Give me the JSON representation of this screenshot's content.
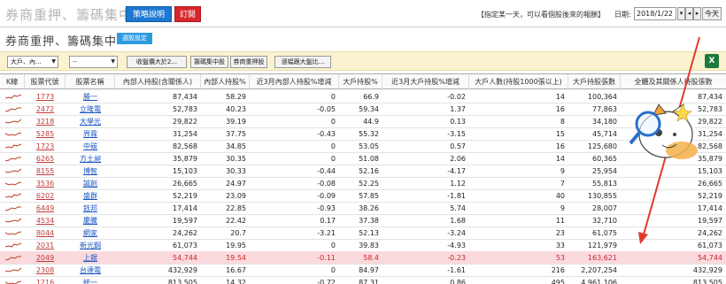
{
  "header": {
    "title": "券商重押、籌碼集中",
    "strategy_button": "策略說明",
    "subscribe_button": "訂閱",
    "hint": "【指定某一天，可以看個股後來的報酬】",
    "date_label": "日期:",
    "date_value": "2018/1/22",
    "today_button": "今天"
  },
  "subheader": {
    "title": "券商重押、籌碼集中",
    "filter_button": "選股設定"
  },
  "filters": {
    "market_select": "大戶、內...",
    "industry_select": "--",
    "buttons": [
      "收盤價大於2...",
      "籌碼集中股",
      "券商重押股",
      "漲幅跟大盤比..."
    ]
  },
  "table": {
    "columns": [
      "K線",
      "股票代號",
      "股票名稱",
      "內部人持股(含關係人)",
      "內部人持股%",
      "近3月內部人持股%增減",
      "大戶持股%",
      "近3月大戶持股%增減",
      "大戶人數(持股1000張以上)",
      "大戶持股張數",
      "全體及其關係人持股張數"
    ],
    "rows": [
      {
        "code": "1773",
        "name": "勝一",
        "insider": "87,434",
        "insider_pct": "58.29",
        "insider_chg": "0",
        "major_pct": "66.9",
        "major_chg": "-0.02",
        "holders": "14",
        "major_shares": "100,364",
        "all_shares": "87,434"
      },
      {
        "code": "2472",
        "name": "立隆電",
        "insider": "52,783",
        "insider_pct": "40.23",
        "insider_chg": "-0.05",
        "major_pct": "59.34",
        "major_chg": "1.37",
        "holders": "16",
        "major_shares": "77,863",
        "all_shares": "52,783"
      },
      {
        "code": "3218",
        "name": "大學光",
        "insider": "29,822",
        "insider_pct": "39.19",
        "insider_chg": "0",
        "major_pct": "44.9",
        "major_chg": "0.13",
        "holders": "8",
        "major_shares": "34,180",
        "all_shares": "29,822"
      },
      {
        "code": "5285",
        "name": "界霖",
        "insider": "31,254",
        "insider_pct": "37.75",
        "insider_chg": "-0.43",
        "major_pct": "55.32",
        "major_chg": "-3.15",
        "holders": "15",
        "major_shares": "45,714",
        "all_shares": "31,254"
      },
      {
        "code": "1723",
        "name": "中碳",
        "insider": "82,568",
        "insider_pct": "34.85",
        "insider_chg": "0",
        "major_pct": "53.05",
        "major_chg": "0.57",
        "holders": "16",
        "major_shares": "125,680",
        "all_shares": "82,568"
      },
      {
        "code": "6265",
        "name": "方土昶",
        "insider": "35,879",
        "insider_pct": "30.35",
        "insider_chg": "0",
        "major_pct": "51.08",
        "major_chg": "2.06",
        "holders": "14",
        "major_shares": "60,365",
        "all_shares": "35,879"
      },
      {
        "code": "8155",
        "name": "博智",
        "insider": "15,103",
        "insider_pct": "30.33",
        "insider_chg": "-0.44",
        "major_pct": "52.16",
        "major_chg": "-4.17",
        "holders": "9",
        "major_shares": "25,954",
        "all_shares": "15,103"
      },
      {
        "code": "3536",
        "name": "誠創",
        "insider": "26,665",
        "insider_pct": "24.97",
        "insider_chg": "-0.08",
        "major_pct": "52.25",
        "major_chg": "1.12",
        "holders": "7",
        "major_shares": "55,813",
        "all_shares": "26,665"
      },
      {
        "code": "6202",
        "name": "盛群",
        "insider": "52,219",
        "insider_pct": "23.09",
        "insider_chg": "-0.09",
        "major_pct": "57.85",
        "major_chg": "-1.81",
        "holders": "40",
        "major_shares": "130,855",
        "all_shares": "52,219"
      },
      {
        "code": "6449",
        "name": "鈺邦",
        "insider": "17,414",
        "insider_pct": "22.85",
        "insider_chg": "-0.93",
        "major_pct": "38.26",
        "major_chg": "5.74",
        "holders": "9",
        "major_shares": "28,007",
        "all_shares": "17,414"
      },
      {
        "code": "4534",
        "name": "慶騰",
        "insider": "19,597",
        "insider_pct": "22.42",
        "insider_chg": "0.17",
        "major_pct": "37.38",
        "major_chg": "1.68",
        "holders": "11",
        "major_shares": "32,710",
        "all_shares": "19,597"
      },
      {
        "code": "8044",
        "name": "網家",
        "insider": "24,262",
        "insider_pct": "20.7",
        "insider_chg": "-3.21",
        "major_pct": "52.13",
        "major_chg": "-3.24",
        "holders": "23",
        "major_shares": "61,075",
        "all_shares": "24,262"
      },
      {
        "code": "2031",
        "name": "新光鋼",
        "insider": "61,073",
        "insider_pct": "19.95",
        "insider_chg": "0",
        "major_pct": "39.83",
        "major_chg": "-4.93",
        "holders": "33",
        "major_shares": "121,979",
        "all_shares": "61,073"
      },
      {
        "code": "2049",
        "name": "上銀",
        "insider": "54,744",
        "insider_pct": "19.54",
        "insider_chg": "-0.11",
        "major_pct": "58.4",
        "major_chg": "-0.23",
        "holders": "53",
        "major_shares": "163,621",
        "all_shares": "54,744",
        "highlight": true
      },
      {
        "code": "2308",
        "name": "台達電",
        "insider": "432,929",
        "insider_pct": "16.67",
        "insider_chg": "0",
        "major_pct": "84.97",
        "major_chg": "-1.61",
        "holders": "216",
        "major_shares": "2,207,254",
        "all_shares": "432,929"
      },
      {
        "code": "1216",
        "name": "統一",
        "insider": "813,505",
        "insider_pct": "14.32",
        "insider_chg": "-0.72",
        "major_pct": "87.31",
        "major_chg": "0.86",
        "holders": "495",
        "major_shares": "4,961,106",
        "all_shares": "813,505"
      }
    ]
  },
  "colors": {
    "accent_blue": "#1e78d2",
    "accent_red": "#d8262b",
    "highlight_row": "#fadadd",
    "annotation": "#e2392e"
  },
  "icons": {
    "excel": "excel-export-icon",
    "mascot": "cat-magnifier-mascot"
  }
}
